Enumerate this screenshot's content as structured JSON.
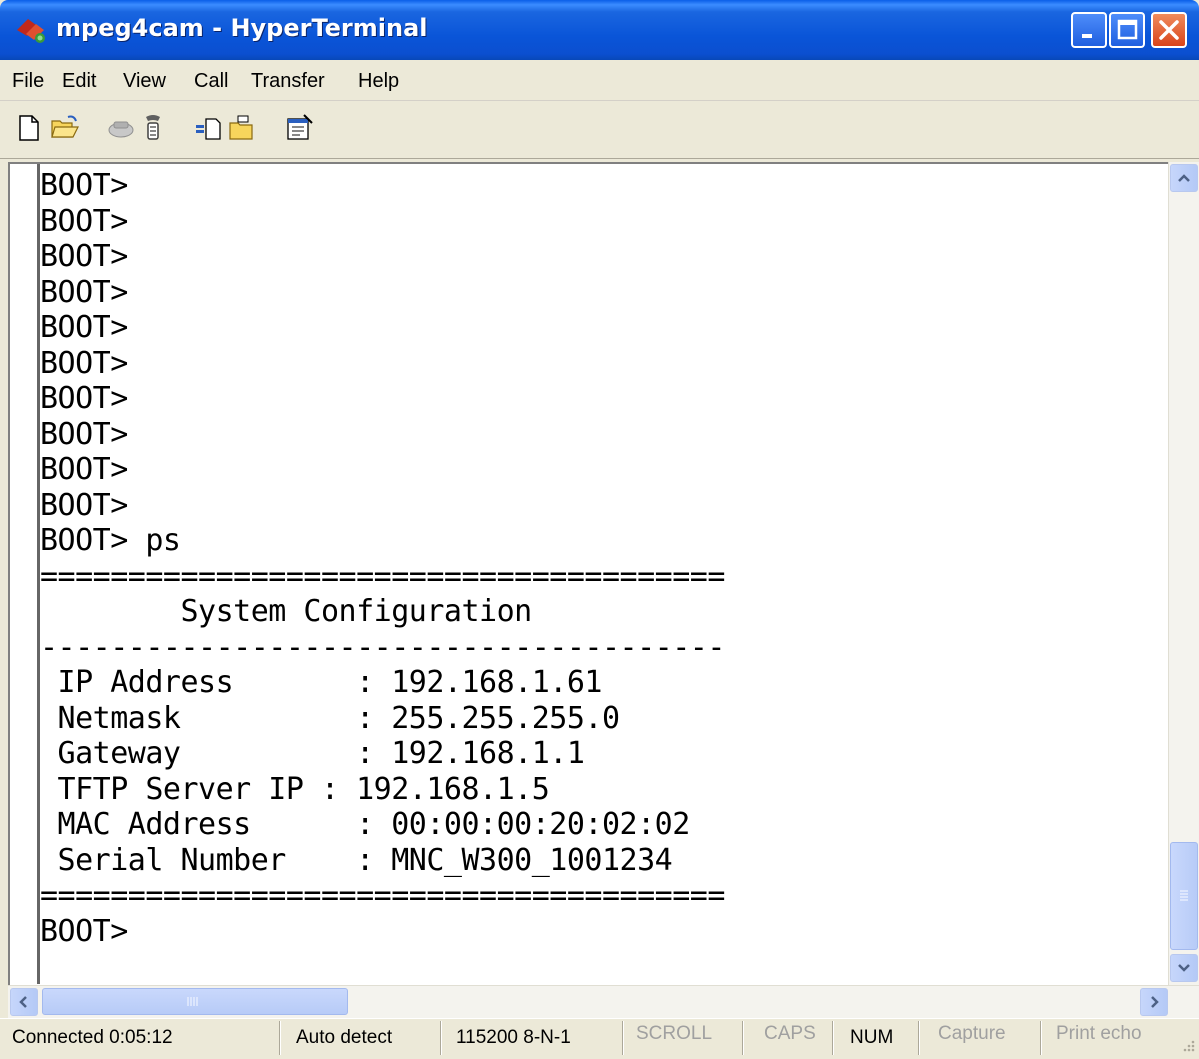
{
  "window": {
    "title": "mpeg4cam - HyperTerminal"
  },
  "menu": [
    "File",
    "Edit",
    "View",
    "Call",
    "Transfer",
    "Help"
  ],
  "toolbar": [
    "new-icon",
    "open-icon",
    "disconnect-icon",
    "connect-icon",
    "send-icon",
    "receive-icon",
    "properties-icon"
  ],
  "terminal": {
    "lines": [
      "BOOT>",
      "BOOT>",
      "BOOT>",
      "BOOT>",
      "BOOT>",
      "BOOT>",
      "BOOT>",
      "BOOT>",
      "BOOT>",
      "BOOT>",
      "BOOT> ps",
      "=======================================",
      "        System Configuration",
      "---------------------------------------",
      " IP Address       : 192.168.1.61",
      " Netmask          : 255.255.255.0",
      " Gateway          : 192.168.1.1",
      " TFTP Server IP : 192.168.1.5",
      " MAC Address      : 00:00:00:20:02:02",
      " Serial Number    : MNC_W300_1001234",
      "=======================================",
      "BOOT>"
    ]
  },
  "status": {
    "connected": "Connected 0:05:12",
    "detect": "Auto detect",
    "port": "115200 8-N-1",
    "scroll": "SCROLL",
    "caps": "CAPS",
    "num": "NUM",
    "capture": "Capture",
    "print_echo": "Print echo"
  }
}
